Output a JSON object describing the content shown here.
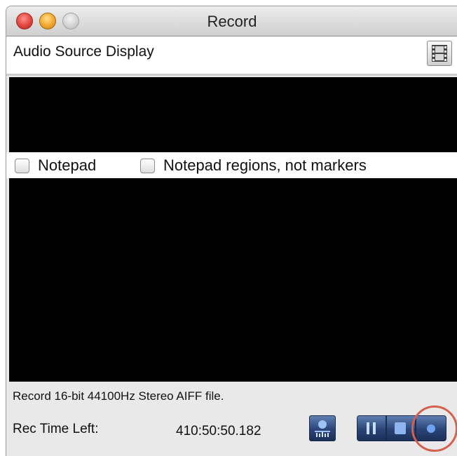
{
  "window": {
    "title": "Record",
    "traffic_lights": [
      "close",
      "minimize",
      "zoom"
    ]
  },
  "source_bar": {
    "label": "Audio Source Display",
    "film_icon": "film-strip-icon"
  },
  "options": {
    "notepad_label": "Notepad",
    "notepad_checked": false,
    "regions_label": "Notepad regions, not markers",
    "regions_checked": false
  },
  "status": {
    "format_text": "Record 16-bit 44100Hz Stereo AIFF file.",
    "time_left_label": "Rec Time Left:",
    "time_left_value": "410:50:50.182"
  },
  "controls": {
    "level_icon": "level-meter-icon",
    "pause_icon": "pause-icon",
    "stop_icon": "stop-icon",
    "record_icon": "record-icon",
    "highlight_color": "#d4614f",
    "button_color": "#2b4477"
  }
}
